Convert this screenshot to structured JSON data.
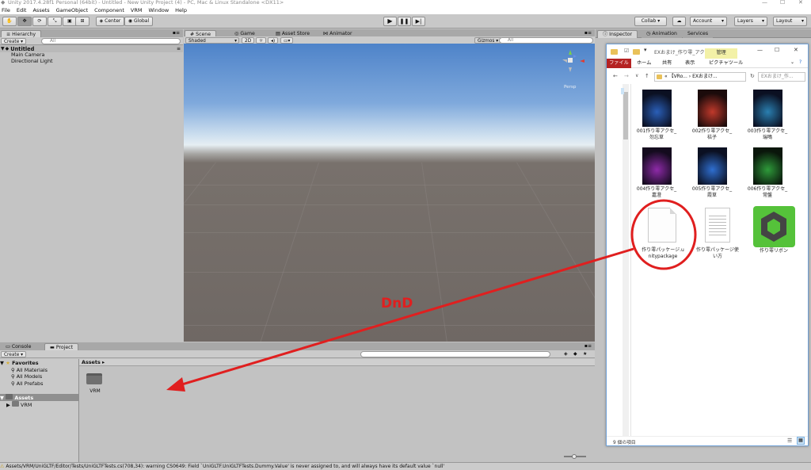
{
  "window": {
    "title": "Unity 2017.4.28f1 Personal (64bit) - Untitled - New Unity Project (4) - PC, Mac & Linux Standalone <DX11>"
  },
  "menu": [
    "File",
    "Edit",
    "Assets",
    "GameObject",
    "Component",
    "VRM",
    "Window",
    "Help"
  ],
  "toolbar": {
    "center_label": "Center",
    "global_label": "Global",
    "collab_label": "Collab ▾",
    "account_label": "Account",
    "layers_label": "Layers",
    "layout_label": "Layout"
  },
  "hierarchy": {
    "tab": "Hierarchy",
    "create_label": "Create ▾",
    "search_placeholder": "All",
    "scene_name": "Untitled",
    "objects": [
      "Main Camera",
      "Directional Light"
    ]
  },
  "scene": {
    "tabs": [
      "Scene",
      "Game",
      "Asset Store",
      "Animator"
    ],
    "shading": "Shaded",
    "mode_2d": "2D",
    "gizmos_label": "Gizmos ▾",
    "search_placeholder": "All",
    "persp_label": "Persp"
  },
  "inspector": {
    "tabs": [
      "Inspector",
      "Animation",
      "Services"
    ]
  },
  "bottom": {
    "tabs": [
      "Console",
      "Project"
    ],
    "create_label": "Create ▾",
    "favorites_label": "Favorites",
    "favorites": [
      "All Materials",
      "All Models",
      "All Prefabs"
    ],
    "assets_label": "Assets",
    "assets_children": [
      "VRM"
    ],
    "breadcrumb": "Assets ▸",
    "folder_items": [
      "VRM"
    ]
  },
  "status": {
    "message": "Assets/VRM/UniGLTF/Editor/Tests/UniGLTFTests.cs(708,34): warning CS0649: Field `UniGLTF.UniGLTFTests.Dummy.Value' is never assigned to, and will always have its default value `null'"
  },
  "annotation": {
    "label": "DnD",
    "color": "#e01f1f"
  },
  "explorer": {
    "title": "EXおまけ_作り零_アク...",
    "ribbon_manage": "管理",
    "ribbon_tabs": [
      "ファイル",
      "ホーム",
      "共有",
      "表示",
      "ピクチャツール"
    ],
    "path": "« 【VRo... › EXおまけ...",
    "search_placeholder": "EXおまけ_作...",
    "files": [
      {
        "name": "001作り零アクセ_勿忘草",
        "tint": "#2a5fb8"
      },
      {
        "name": "002作り零アクセ_桔子",
        "tint": "#c0392b"
      },
      {
        "name": "003作り零アクセ_瑞鳴",
        "tint": "#2a7fb0"
      },
      {
        "name": "004作り零アクセ_嘉澄",
        "tint": "#8e2aa8"
      },
      {
        "name": "005作り零アクセ_霞草",
        "tint": "#2f6fd0"
      },
      {
        "name": "006作り零アクセ_常盤",
        "tint": "#2e9a3a"
      }
    ],
    "package_file": "作り零パッケージ.unitypackage",
    "doc_file": "作り零パッケージ使い方",
    "app_file": "作り零リボン",
    "status": "9 個の項目"
  }
}
